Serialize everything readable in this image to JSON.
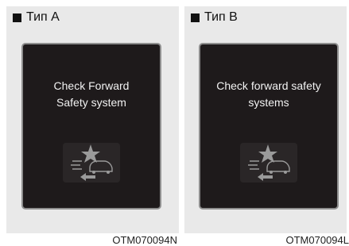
{
  "panels": [
    {
      "type_label": "Тип A",
      "message_lines": [
        "Check Forward",
        "Safety system"
      ],
      "code": "OTM070094N"
    },
    {
      "type_label": "Тип B",
      "message_lines": [
        "Check forward safety",
        "systems"
      ],
      "code": "OTM070094L"
    }
  ],
  "icons": {
    "type_marker": "square-bullet-icon",
    "warning": "forward-collision-warning-icon"
  },
  "colors": {
    "screen_bg": "#1e1a1b",
    "screen_border": "#8e8e8e",
    "panel_bg": "#e9e9e9",
    "text_on_screen": "#f2f2f2",
    "icon_gray": "#9a9a9a"
  }
}
